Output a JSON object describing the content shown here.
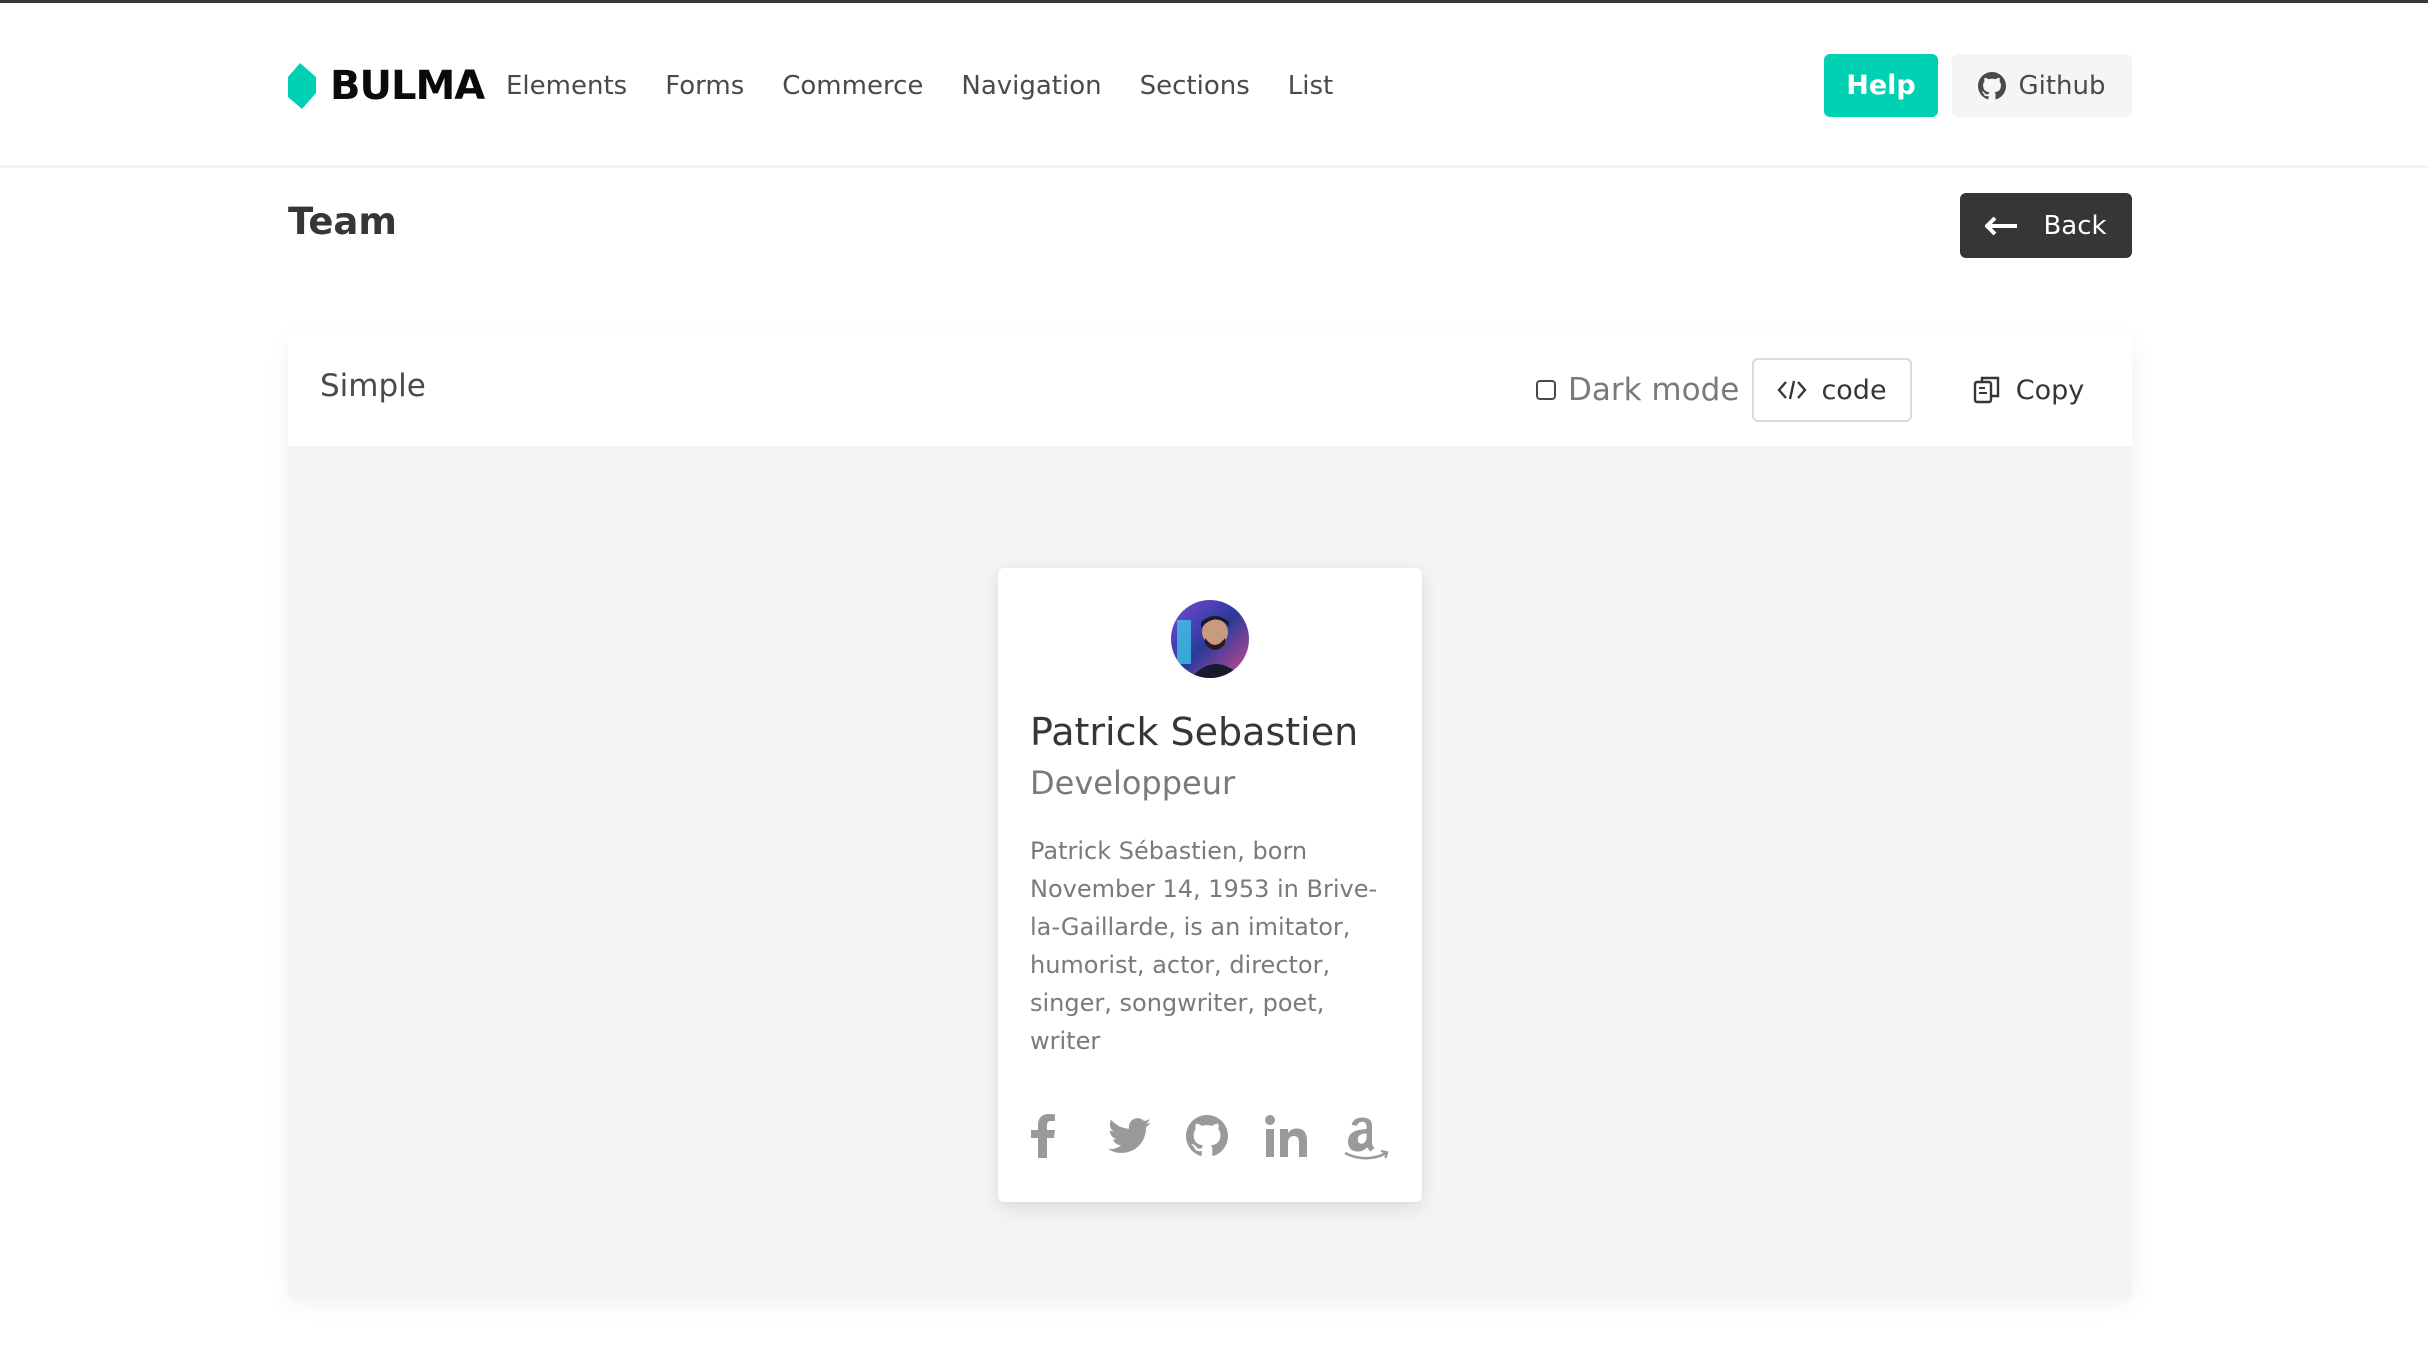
{
  "brand": {
    "name": "BULMA",
    "accent": "#00d1b2"
  },
  "nav": {
    "items": [
      {
        "label": "Elements"
      },
      {
        "label": "Forms"
      },
      {
        "label": "Commerce"
      },
      {
        "label": "Navigation"
      },
      {
        "label": "Sections"
      },
      {
        "label": "List"
      }
    ],
    "help_label": "Help",
    "github_label": "Github",
    "github_icon": "github-icon"
  },
  "header": {
    "title": "Team",
    "back_label": "Back",
    "back_icon": "arrow-left-icon"
  },
  "panel": {
    "title": "Simple",
    "dark_mode_label": "Dark mode",
    "dark_mode_checked": false,
    "code_label": "code",
    "code_icon": "code-icon",
    "copy_label": "Copy",
    "copy_icon": "copy-icon"
  },
  "card": {
    "name": "Patrick Sebastien",
    "role": "Developpeur",
    "bio": "Patrick Sébastien, born November 14, 1953 in Brive-la-Gaillarde, is an imitator, humorist, actor, director, singer, songwriter, poet, writer",
    "avatar_icon": "avatar-photo",
    "socials": [
      {
        "icon": "facebook-icon"
      },
      {
        "icon": "twitter-icon"
      },
      {
        "icon": "github-icon"
      },
      {
        "icon": "linkedin-icon"
      },
      {
        "icon": "amazon-icon"
      }
    ]
  },
  "colors": {
    "primary": "#00d1b2",
    "dark": "#363636",
    "panel_bg": "#f4f4f4",
    "icon_gray": "#9a9a9a"
  }
}
